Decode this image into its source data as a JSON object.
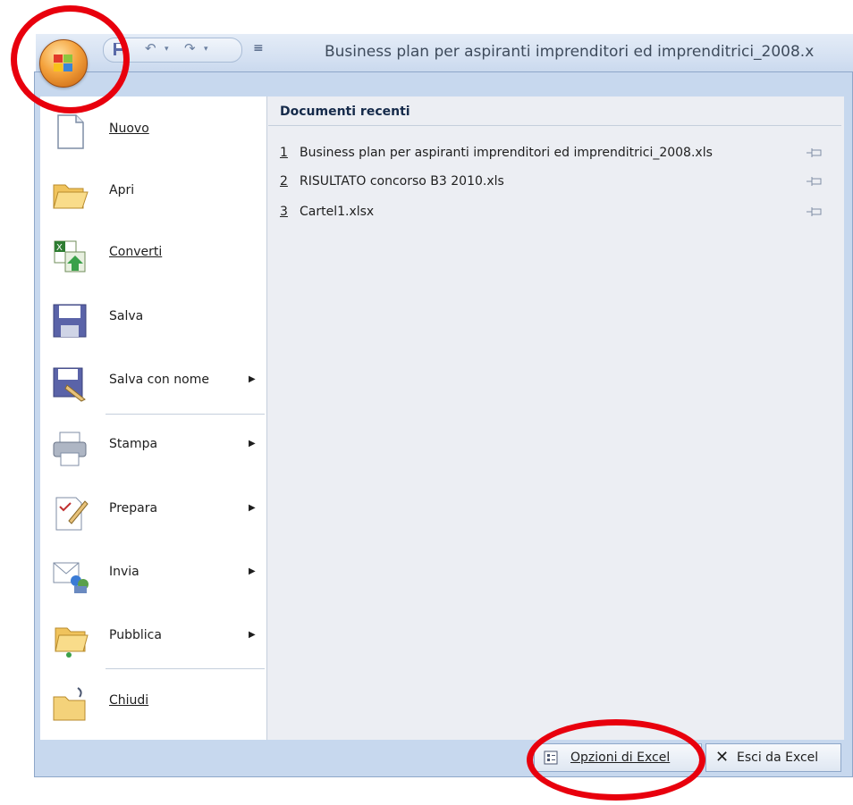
{
  "window": {
    "title": "Business plan per aspiranti imprenditori ed imprenditrici_2008.x"
  },
  "qat": {
    "save_icon": "save-icon",
    "undo_icon": "undo-icon",
    "redo_icon": "redo-icon",
    "customize_glyph": "≡"
  },
  "office_button": {
    "icon": "office-logo-icon"
  },
  "menu": {
    "items": [
      {
        "label": "Nuovo",
        "icon": "new-document-icon"
      },
      {
        "label": "Apri",
        "icon": "open-folder-icon"
      },
      {
        "label": "Converti",
        "icon": "convert-icon"
      },
      {
        "label": "Salva",
        "icon": "save-icon"
      },
      {
        "label": "Salva con nome",
        "icon": "save-as-icon",
        "submenu": true
      },
      {
        "label": "Stampa",
        "icon": "print-icon",
        "submenu": true
      },
      {
        "label": "Prepara",
        "icon": "prepare-icon",
        "submenu": true
      },
      {
        "label": "Invia",
        "icon": "send-icon",
        "submenu": true
      },
      {
        "label": "Pubblica",
        "icon": "publish-icon",
        "submenu": true
      },
      {
        "label": "Chiudi",
        "icon": "close-folder-icon"
      }
    ],
    "submenu_arrow": "▶"
  },
  "recent": {
    "header": "Documenti recenti",
    "items": [
      {
        "num": "1",
        "name": "Business plan per aspiranti imprenditori ed imprenditrici_2008.xls"
      },
      {
        "num": "2",
        "name": "RISULTATO concorso B3 2010.xls"
      },
      {
        "num": "3",
        "name": "Cartel1.xlsx"
      }
    ]
  },
  "footer": {
    "options_label": "Opzioni di Excel",
    "exit_label": "Esci da Excel",
    "exit_glyph": "✕"
  },
  "colors": {
    "annotation_red": "#e8000d",
    "frame_blue": "#c7d8ee"
  }
}
